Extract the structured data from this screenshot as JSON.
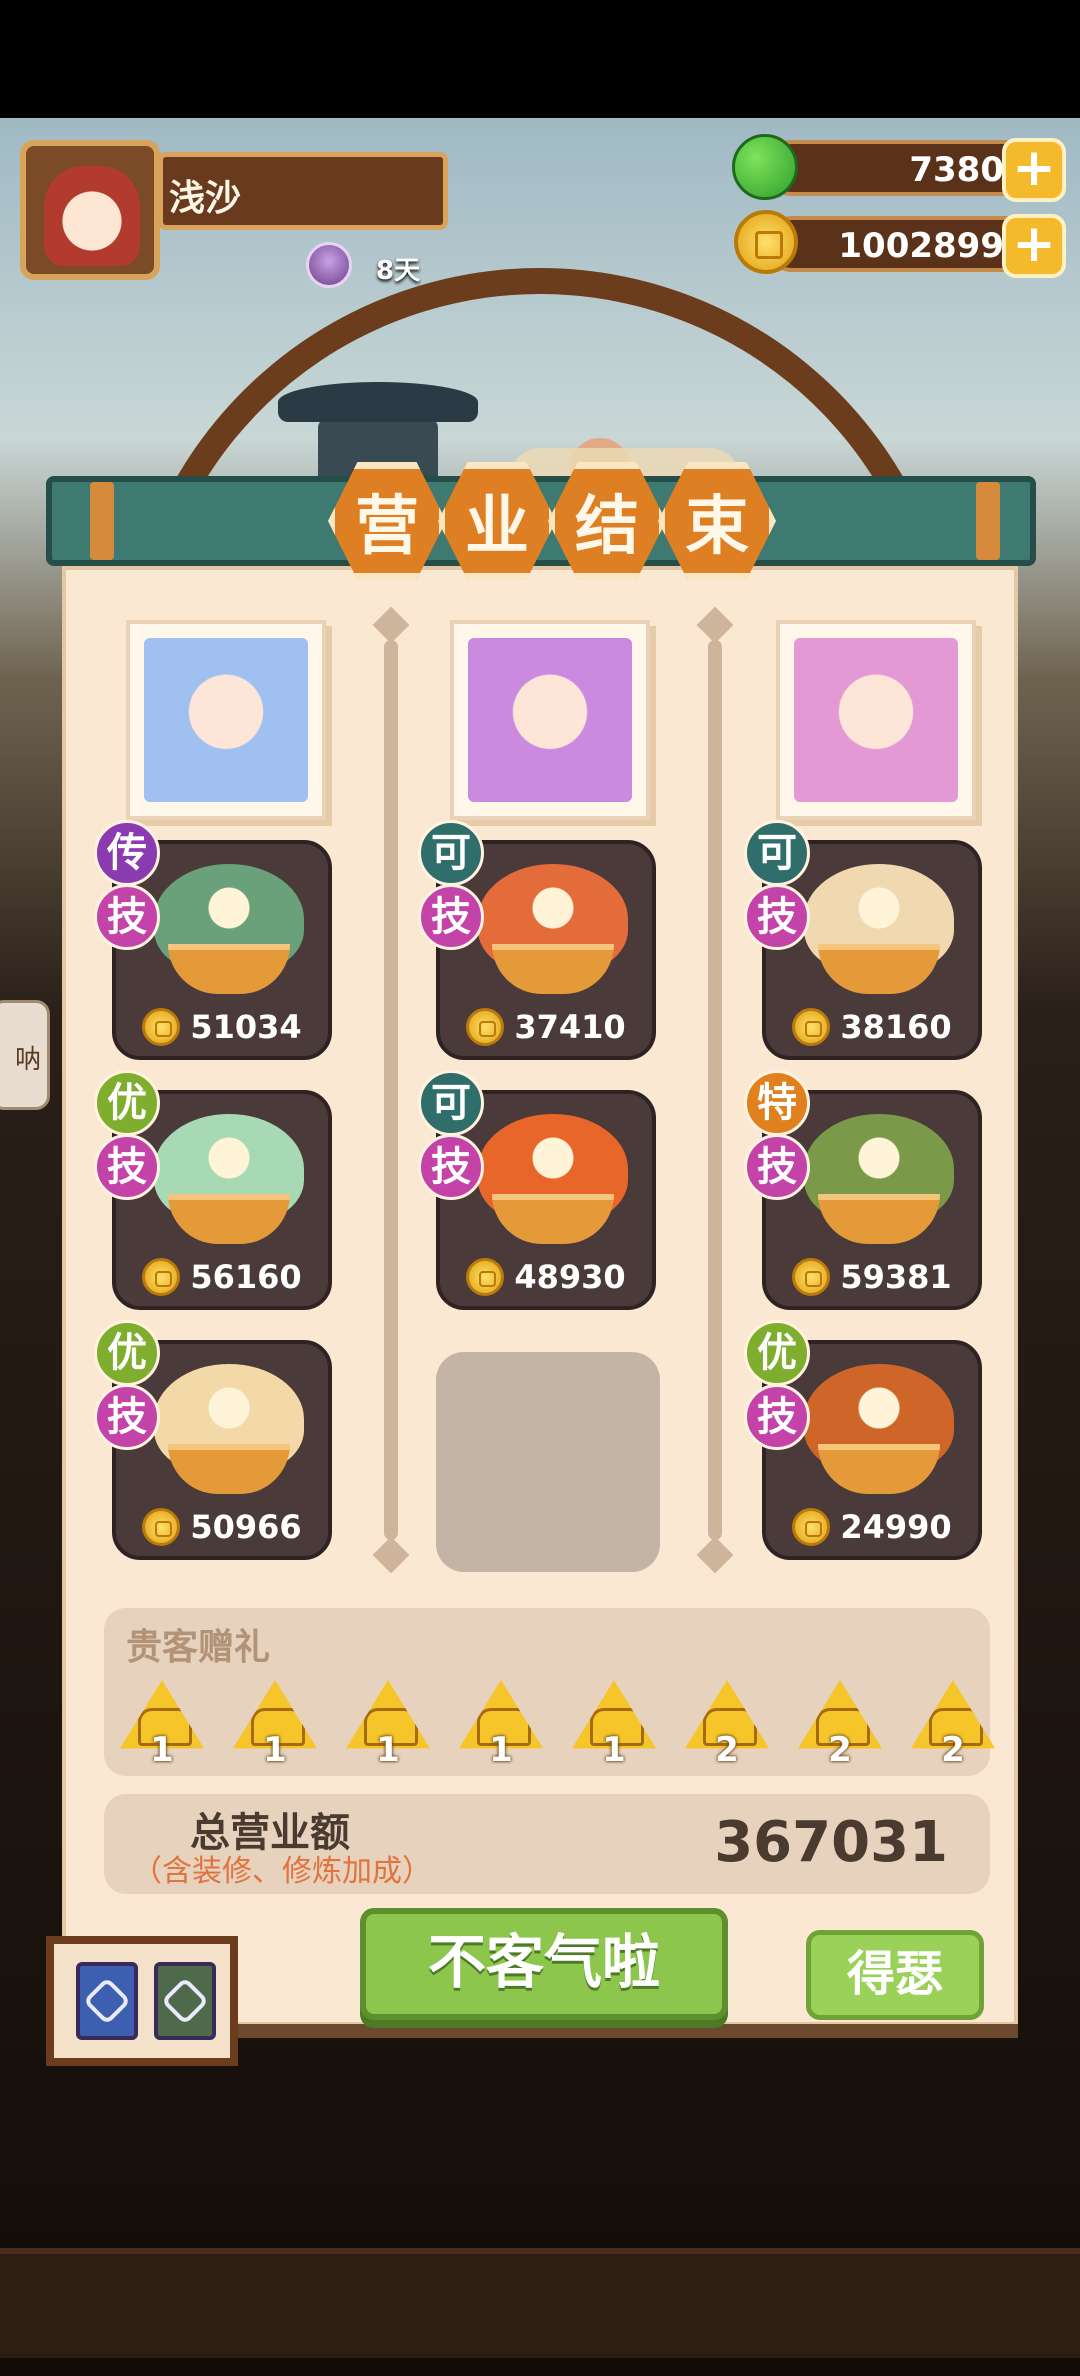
{
  "player": {
    "name": "浅沙",
    "days": "8天",
    "avatar_icon": "chef-avatar-icon",
    "day_icon": "fairy-icon"
  },
  "resources": [
    {
      "name": "apple",
      "icon": "apple-icon",
      "value": "7380",
      "plus": "+"
    },
    {
      "name": "coin",
      "icon": "coin-icon",
      "value": "1002899",
      "plus": "+"
    }
  ],
  "title_chars": [
    "营",
    "业",
    "结",
    "束"
  ],
  "chefs": [
    {
      "portrait_icon": "white-hair-chef-portrait",
      "color": "#9fc0f0"
    },
    {
      "portrait_icon": "purple-hair-chef-portrait",
      "color": "#c98ae0"
    },
    {
      "portrait_icon": "pink-crown-chef-portrait",
      "color": "#e39ad4"
    }
  ],
  "dishes": [
    {
      "rank": "传",
      "rank_color": "#8a3bb0",
      "skill": "技",
      "price": "51034",
      "art": "#6aa07a"
    },
    {
      "rank": "可",
      "rank_color": "#2f6e6a",
      "skill": "技",
      "price": "37410",
      "art": "#e46c3a"
    },
    {
      "rank": "可",
      "rank_color": "#2f6e6a",
      "skill": "技",
      "price": "38160",
      "art": "#f0d9b0"
    },
    {
      "rank": "优",
      "rank_color": "#7fae2f",
      "skill": "技",
      "price": "56160",
      "art": "#a6d9b4"
    },
    {
      "rank": "可",
      "rank_color": "#2f6e6a",
      "skill": "技",
      "price": "48930",
      "art": "#e8662a"
    },
    {
      "rank": "特",
      "rank_color": "#e0801f",
      "skill": "技",
      "price": "59381",
      "art": "#7a9a4a"
    },
    {
      "rank": "优",
      "rank_color": "#7fae2f",
      "skill": "技",
      "price": "50966",
      "art": "#f4d9a8"
    },
    {
      "rank": "优",
      "rank_color": "#7fae2f",
      "skill": "技",
      "price": "24990",
      "art": "#d0652a"
    }
  ],
  "gifts": {
    "title": "贵客赠礼",
    "items": [
      {
        "icon": "coral-gift-icon",
        "count": "1"
      },
      {
        "icon": "coral-gift-icon",
        "count": "1"
      },
      {
        "icon": "coral-gift-icon",
        "count": "1"
      },
      {
        "icon": "coral-gift-icon",
        "count": "1"
      },
      {
        "icon": "fish-gift-icon",
        "count": "1"
      },
      {
        "icon": "fish-gift-icon",
        "count": "2"
      },
      {
        "icon": "star-gift-icon",
        "count": "2"
      },
      {
        "icon": "star-gift-icon",
        "count": "2"
      }
    ]
  },
  "total": {
    "label": "总营业额",
    "sub": "（含装修、修炼加成）",
    "value": "367031"
  },
  "buttons": {
    "main": "不客气啦",
    "alt": "得瑟"
  },
  "side_button": "呐"
}
